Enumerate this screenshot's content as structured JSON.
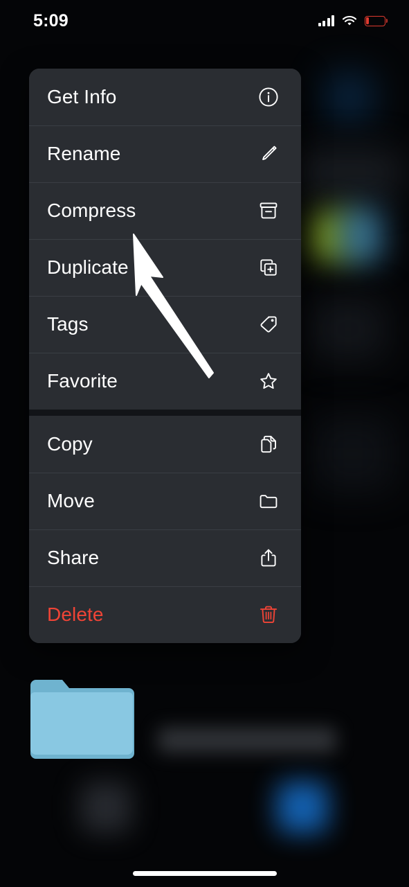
{
  "status_bar": {
    "time": "5:09",
    "cellular_icon": "signal-bars-icon",
    "wifi_icon": "wifi-icon",
    "battery_icon": "battery-low-icon",
    "battery_color": "#e03a2f",
    "battery_level_low": true
  },
  "context_menu": {
    "background_color": "#2a2d32",
    "separator_color": "#3a3e44",
    "text_color": "#ffffff",
    "destructive_color": "#f04436",
    "groups": [
      {
        "items": [
          {
            "label": "Get Info",
            "icon": "info-circle-icon",
            "destructive": false
          },
          {
            "label": "Rename",
            "icon": "pencil-icon",
            "destructive": false
          },
          {
            "label": "Compress",
            "icon": "archive-box-icon",
            "destructive": false
          },
          {
            "label": "Duplicate",
            "icon": "duplicate-icon",
            "destructive": false
          },
          {
            "label": "Tags",
            "icon": "tag-icon",
            "destructive": false
          },
          {
            "label": "Favorite",
            "icon": "star-icon",
            "destructive": false
          }
        ]
      },
      {
        "items": [
          {
            "label": "Copy",
            "icon": "copy-documents-icon",
            "destructive": false
          },
          {
            "label": "Move",
            "icon": "folder-icon",
            "destructive": false
          },
          {
            "label": "Share",
            "icon": "share-export-icon",
            "destructive": false
          },
          {
            "label": "Delete",
            "icon": "trash-icon",
            "destructive": true
          }
        ]
      }
    ]
  },
  "pointer": {
    "icon": "mouse-cursor-arrow",
    "color": "#ffffff",
    "points_at": "Compress"
  },
  "file_item": {
    "icon": "folder-icon",
    "folder_color": "#82c5e0",
    "name_redacted": true
  },
  "home_indicator": {
    "icon": "home-indicator",
    "color": "#ffffff"
  }
}
